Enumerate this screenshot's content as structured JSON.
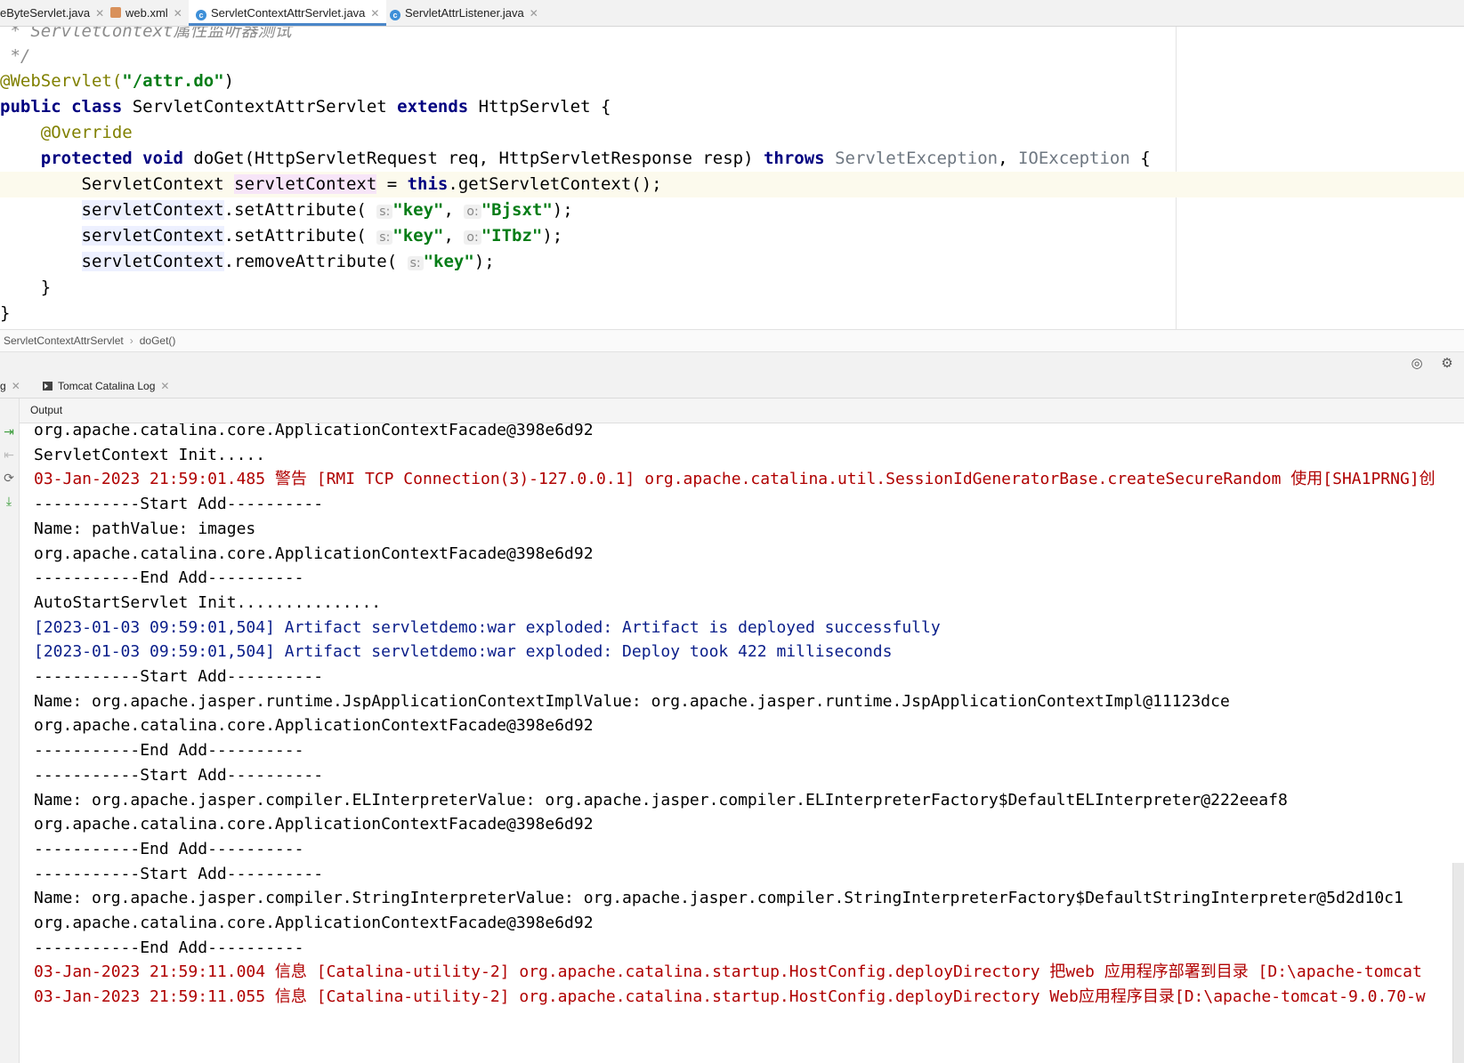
{
  "tabs": [
    {
      "label": "eByteServlet.java",
      "icon": "java-class-icon"
    },
    {
      "label": "web.xml",
      "icon": "xml-file-icon"
    },
    {
      "label": "ServletContextAttrServlet.java",
      "icon": "java-class-icon",
      "active": true
    },
    {
      "label": "ServletAttrListener.java",
      "icon": "java-class-icon"
    }
  ],
  "code": {
    "l1": "* ServletContext属性监听器测试",
    "l1_star": " * ",
    "l1_comment": "ServletContext属性监听器测试",
    "l2": " */",
    "l3_ann": "@WebServlet(",
    "l3_str": "\"/attr.do\"",
    "l3_end": ")",
    "l4_kw1": "public",
    "l4_kw2": "class",
    "l4_name": " ServletContextAttrServlet ",
    "l4_kw3": "extends",
    "l4_rest": " HttpServlet {",
    "l5_ann": "@Override",
    "l6_kw1": "protected",
    "l6_kw2": "void",
    "l6_sig": " doGet(HttpServletRequest req, HttpServletResponse resp) ",
    "l6_kw3": "throws",
    "l6_ex1": "ServletException",
    "l6_comma": ", ",
    "l6_ex2": "IOException",
    "l6_end": " {",
    "l7_type": "ServletContext",
    "l7_var": "servletContext",
    "l7_eq": " = ",
    "l7_this": "this",
    "l7_call": ".getServletContext();",
    "var": "servletContext",
    "set_call": ".setAttribute(",
    "remove_call": ".removeAttribute(",
    "hint_s": "s:",
    "hint_o": "o:",
    "str_key": "\"key\"",
    "str_bjsxt": "\"Bjsxt\"",
    "str_itbz": "\"ITbz\"",
    "close_args": ");",
    "comma": ", ",
    "brace_in": "}",
    "brace_out": "}"
  },
  "breadcrumb": {
    "class": "ServletContextAttrServlet",
    "method": "doGet()"
  },
  "run_tabs": [
    {
      "label": "g"
    },
    {
      "label": "Tomcat Catalina Log"
    }
  ],
  "output_label": "Output",
  "console": [
    {
      "text": "org.apache.catalina.core.ApplicationContextFacade@398e6d92",
      "style": "normal"
    },
    {
      "text": "ServletContext Init.....",
      "style": "normal"
    },
    {
      "text": "03-Jan-2023 21:59:01.485 警告 [RMI TCP Connection(3)-127.0.0.1] org.apache.catalina.util.SessionIdGeneratorBase.createSecureRandom 使用[SHA1PRNG]创",
      "style": "red"
    },
    {
      "text": "-----------Start Add----------",
      "style": "normal"
    },
    {
      "text": "Name: pathValue: images",
      "style": "normal"
    },
    {
      "text": "org.apache.catalina.core.ApplicationContextFacade@398e6d92",
      "style": "normal"
    },
    {
      "text": "-----------End Add----------",
      "style": "normal"
    },
    {
      "text": "AutoStartServlet Init...............",
      "style": "normal"
    },
    {
      "text": "[2023-01-03 09:59:01,504] Artifact servletdemo:war exploded: Artifact is deployed successfully",
      "style": "blue"
    },
    {
      "text": "[2023-01-03 09:59:01,504] Artifact servletdemo:war exploded: Deploy took 422 milliseconds",
      "style": "blue"
    },
    {
      "text": "-----------Start Add----------",
      "style": "normal"
    },
    {
      "text": "Name: org.apache.jasper.runtime.JspApplicationContextImplValue: org.apache.jasper.runtime.JspApplicationContextImpl@11123dce",
      "style": "normal"
    },
    {
      "text": "org.apache.catalina.core.ApplicationContextFacade@398e6d92",
      "style": "normal"
    },
    {
      "text": "-----------End Add----------",
      "style": "normal"
    },
    {
      "text": "-----------Start Add----------",
      "style": "normal"
    },
    {
      "text": "Name: org.apache.jasper.compiler.ELInterpreterValue: org.apache.jasper.compiler.ELInterpreterFactory$DefaultELInterpreter@222eeaf8",
      "style": "normal"
    },
    {
      "text": "org.apache.catalina.core.ApplicationContextFacade@398e6d92",
      "style": "normal"
    },
    {
      "text": "-----------End Add----------",
      "style": "normal"
    },
    {
      "text": "-----------Start Add----------",
      "style": "normal"
    },
    {
      "text": "Name: org.apache.jasper.compiler.StringInterpreterValue: org.apache.jasper.compiler.StringInterpreterFactory$DefaultStringInterpreter@5d2d10c1",
      "style": "normal"
    },
    {
      "text": "org.apache.catalina.core.ApplicationContextFacade@398e6d92",
      "style": "normal"
    },
    {
      "text": "-----------End Add----------",
      "style": "normal"
    },
    {
      "text": "03-Jan-2023 21:59:11.004 信息 [Catalina-utility-2] org.apache.catalina.startup.HostConfig.deployDirectory 把web 应用程序部署到目录 [D:\\apache-tomcat",
      "style": "red"
    },
    {
      "text": "03-Jan-2023 21:59:11.055 信息 [Catalina-utility-2] org.apache.catalina.startup.HostConfig.deployDirectory Web应用程序目录[D:\\apache-tomcat-9.0.70-w",
      "style": "red"
    }
  ],
  "colors": {
    "accent": "#4a86c8",
    "keyword": "#000080",
    "string": "#067d17",
    "annotation": "#808000",
    "error": "#b00000",
    "info_blue": "#0a1e8a"
  }
}
